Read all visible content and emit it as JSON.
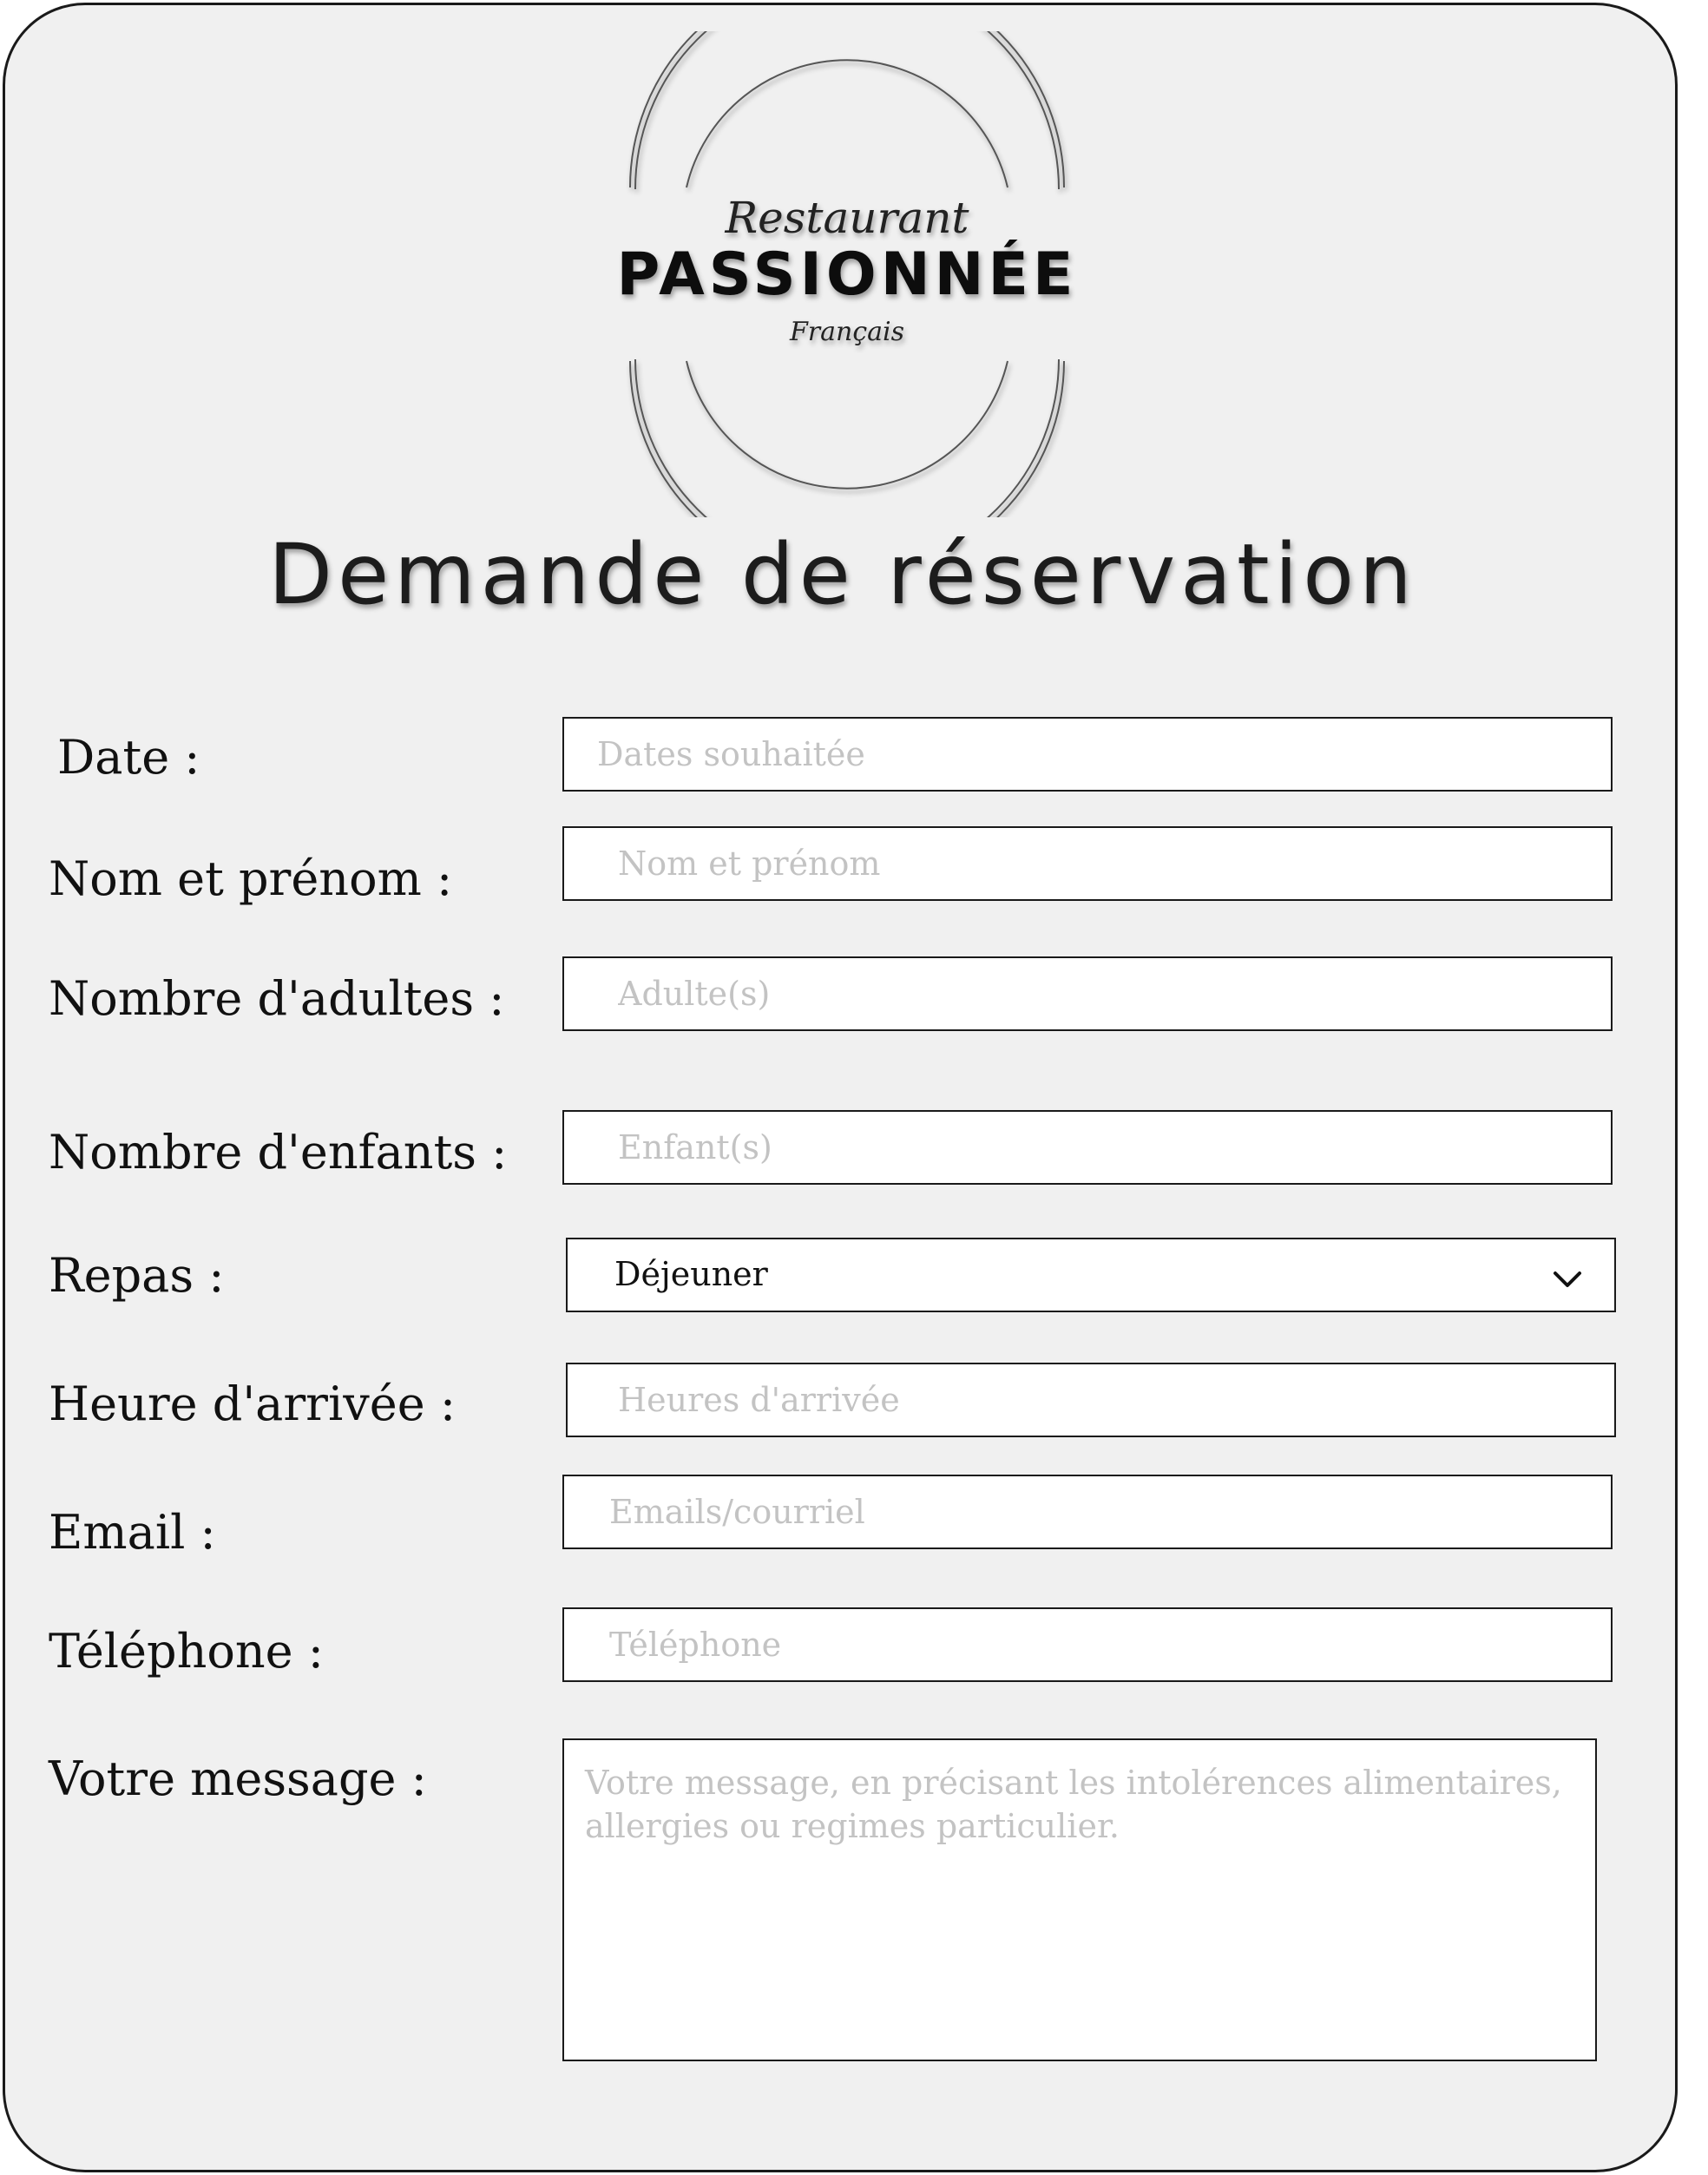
{
  "logo": {
    "line1": "Restaurant",
    "line2": "PASSIONNÉE",
    "line3": "Français"
  },
  "title": "Demande de réservation",
  "form": {
    "date": {
      "label": "Date :",
      "placeholder": "Dates souhaitée",
      "value": ""
    },
    "name": {
      "label": "Nom et prénom :",
      "placeholder": "Nom et prénom",
      "value": ""
    },
    "adults": {
      "label": "Nombre d'adultes :",
      "placeholder": "Adulte(s)",
      "value": ""
    },
    "children": {
      "label": "Nombre d'enfants :",
      "placeholder": "Enfant(s)",
      "value": ""
    },
    "meal": {
      "label": "Repas :",
      "value": "Déjeuner"
    },
    "arrival": {
      "label": "Heure d'arrivée :",
      "placeholder": "Heures d'arrivée",
      "value": ""
    },
    "email": {
      "label": "Email :",
      "placeholder": "Emails/courriel",
      "value": ""
    },
    "phone": {
      "label": "Téléphone :",
      "placeholder": "Téléphone",
      "value": ""
    },
    "message": {
      "label": "Votre message :",
      "placeholder": "Votre message, en précisant les intolérences alimentaires, allergies ou regimes particulier.",
      "value": ""
    }
  },
  "icons": {
    "select_arrow": "chevron-down-icon"
  },
  "colors": {
    "background": "#f0f0f0",
    "border": "#1a1a1a",
    "placeholder": "#c3c3c3"
  }
}
